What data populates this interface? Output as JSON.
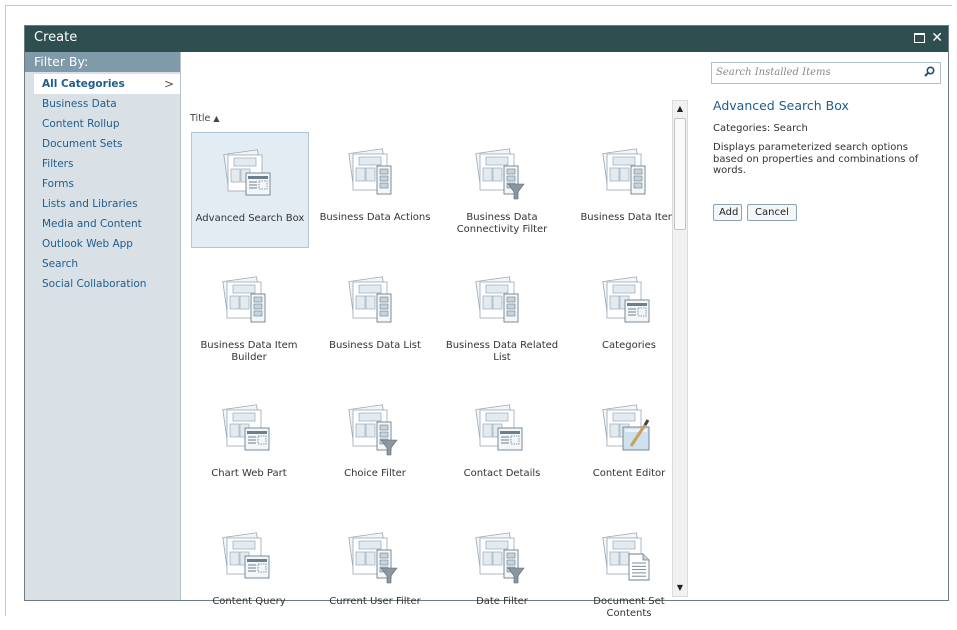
{
  "dialog": {
    "title": "Create"
  },
  "sidebar": {
    "header": "Filter By:",
    "categories": [
      {
        "label": "All Categories",
        "active": true
      },
      {
        "label": "Business Data"
      },
      {
        "label": "Content Rollup"
      },
      {
        "label": "Document Sets"
      },
      {
        "label": "Filters"
      },
      {
        "label": "Forms"
      },
      {
        "label": "Lists and Libraries"
      },
      {
        "label": "Media and Content"
      },
      {
        "label": "Outlook Web App"
      },
      {
        "label": "Search"
      },
      {
        "label": "Social Collaboration"
      }
    ],
    "active_chevron": ">"
  },
  "main": {
    "sort_label": "Title",
    "sort_direction_icon": "sort-ascending-icon",
    "items": [
      {
        "label": "Advanced Search Box",
        "icon": "web-part-document-icon",
        "selected": true
      },
      {
        "label": "Business Data Actions",
        "icon": "web-part-list-icon"
      },
      {
        "label": "Business Data Connectivity Filter",
        "icon": "web-part-filter-icon"
      },
      {
        "label": "Business Data Item",
        "icon": "web-part-list-icon"
      },
      {
        "label": "Business Data Item Builder",
        "icon": "web-part-list-icon"
      },
      {
        "label": "Business Data List",
        "icon": "web-part-list-icon"
      },
      {
        "label": "Business Data Related List",
        "icon": "web-part-list-icon"
      },
      {
        "label": "Categories",
        "icon": "web-part-document-icon"
      },
      {
        "label": "Chart Web Part",
        "icon": "web-part-document-icon"
      },
      {
        "label": "Choice Filter",
        "icon": "web-part-filter-icon"
      },
      {
        "label": "Contact Details",
        "icon": "web-part-document-icon"
      },
      {
        "label": "Content Editor",
        "icon": "web-part-editor-icon"
      },
      {
        "label": "Content Query",
        "icon": "web-part-document-icon"
      },
      {
        "label": "Current User Filter",
        "icon": "web-part-filter-icon"
      },
      {
        "label": "Date Filter",
        "icon": "web-part-filter-icon"
      },
      {
        "label": "Document Set Contents",
        "icon": "web-part-page-icon"
      }
    ]
  },
  "details": {
    "search_placeholder": "Search Installed Items",
    "selected_title": "Advanced Search Box",
    "categories_text": "Categories: Search",
    "description": "Displays parameterized search options based on properties and combinations of words.",
    "add_label": "Add",
    "cancel_label": "Cancel"
  },
  "colors": {
    "titlebar": "#2e4e4f",
    "sidebar_header": "#7f9aa8",
    "sidebar_bg": "#d9e1e6",
    "link": "#1f5d8c"
  }
}
